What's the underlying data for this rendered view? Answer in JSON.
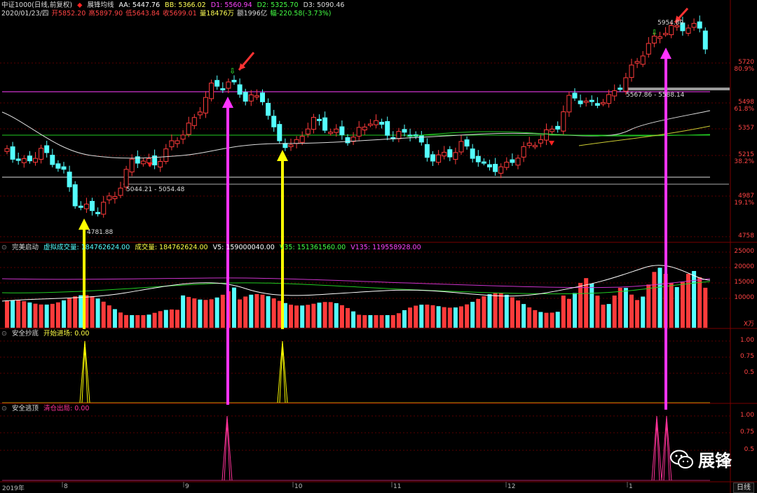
{
  "header": {
    "index_name": "中证1000(日线,前复权)",
    "indicator_name": "展锋均线",
    "aa": "AA: 5447.76",
    "bb": "BB: 5366.02",
    "d1": "D1: 5560.94",
    "d2": "D2: 5325.70",
    "d3": "D3: 5090.46",
    "date": "2020/01/23/四",
    "open": "开5852.20",
    "high": "高5897.90",
    "low": "低5643.84",
    "close": "收5699.01",
    "volume": "量18476万",
    "amount": "额1996亿",
    "change": "幅-220.58(-3.73%)"
  },
  "colors": {
    "up": "#ff3b3b",
    "down": "#54ffff",
    "purple_line": "#cc33cc",
    "green_line": "#22cc22",
    "white_line": "#dddddd",
    "yellow_line": "#cccc33",
    "arrow_yellow": "#ffff00",
    "arrow_magenta": "#ff33ff",
    "signal_yellow": "#ffff00",
    "signal_pink": "#ff3399",
    "grid": "#8b0000"
  },
  "main_chart": {
    "price_axis": [
      {
        "price": "5720",
        "pct": "80.9%"
      },
      {
        "price": "5498",
        "pct": "61.8%"
      },
      {
        "price": "5357",
        "pct": ""
      },
      {
        "price": "5215",
        "pct": "38.2%"
      },
      {
        "price": "4987",
        "pct": "19.1%"
      },
      {
        "price": "4758",
        "pct": ""
      }
    ],
    "annotations": {
      "low_label": "4781.88",
      "range1": "5044.21 - 5054.48",
      "range2": "5567.86 - 5588.14",
      "high_label": "5954.89"
    },
    "signal_glyph": "⇩"
  },
  "volume_panel": {
    "title": "完美启动",
    "virtual_vol": "虚拟成交量: 184762624.00",
    "vol": "成交量: 184762624.00",
    "v5": "V5: 159000040.00",
    "v35": "V35: 151361560.00",
    "v135": "V135: 119558928.00",
    "axis": [
      "25000",
      "20000",
      "15000",
      "10000"
    ],
    "unit": "X万"
  },
  "panel_buy": {
    "title": "安全抄底",
    "signal_label": "开始进场: 0.00",
    "axis": [
      "1.00",
      "0.75",
      "0.5"
    ]
  },
  "panel_sell": {
    "title": "安全逃顶",
    "signal_label": "清仓出局: 0.00",
    "axis": [
      "1.00",
      "0.75",
      "0.5"
    ]
  },
  "timeline": {
    "labels": [
      {
        "text": "2019年"
      },
      {
        "text": "8"
      },
      {
        "text": "9"
      },
      {
        "text": "10"
      },
      {
        "text": "11"
      },
      {
        "text": "12"
      },
      {
        "text": "1"
      }
    ],
    "period": "日线"
  },
  "watermark": "展锋"
}
